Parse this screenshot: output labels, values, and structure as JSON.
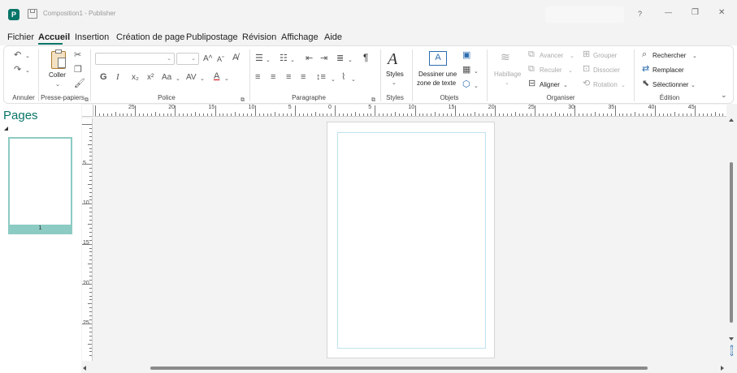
{
  "app": {
    "logo_letter": "P",
    "title": "Composition1 - Publisher",
    "window_controls": {
      "help": "?",
      "minimize": "—",
      "restore": "❐",
      "close": "✕"
    }
  },
  "menu": {
    "tabs": [
      "Fichier",
      "Accueil",
      "Insertion",
      "Création de page",
      "Publipostage",
      "Révision",
      "Affichage",
      "Aide"
    ],
    "active": "Accueil"
  },
  "ribbon": {
    "groups": {
      "undo": "Annuler",
      "clipboard": "Presse-papiers",
      "font": "Police",
      "paragraph": "Paragraphe",
      "styles": "Styles",
      "objects": "Objets",
      "arrange": "Organiser",
      "editing": "Édition"
    },
    "coller": "Coller",
    "bold": "G",
    "italic": "I",
    "subscript": "x₂",
    "superscript": "x²",
    "change_case": "Aa",
    "char_spacing": "AV",
    "font_color": "A",
    "grow_font": "A^",
    "shrink_font": "Aˇ",
    "pilcrow": "¶",
    "styles_label": "Styles",
    "draw_textbox_line1": "Dessiner une",
    "draw_textbox_line2": "zone de texte",
    "habillage": "Habillage",
    "avancer": "Avancer",
    "reculer": "Reculer",
    "aligner": "Aligner",
    "grouper": "Grouper",
    "dissocier": "Dissocier",
    "rotation": "Rotation",
    "rechercher": "Rechercher",
    "remplacer": "Remplacer",
    "selectionner": "Sélectionner"
  },
  "pages_pane": {
    "title": "Pages",
    "pages": [
      {
        "number": "1"
      }
    ]
  },
  "ruler": {
    "h_labels": [
      "25",
      "20",
      "15",
      "10",
      "5",
      "0",
      "5",
      "10",
      "15",
      "20",
      "25",
      "30",
      "35",
      "40",
      "45"
    ],
    "v_labels": [
      "5",
      "10",
      "15",
      "20",
      "25"
    ]
  },
  "colors": {
    "accent": "#077568",
    "ribbon_border": "#e1e1e1",
    "background": "#f3f3f3"
  }
}
